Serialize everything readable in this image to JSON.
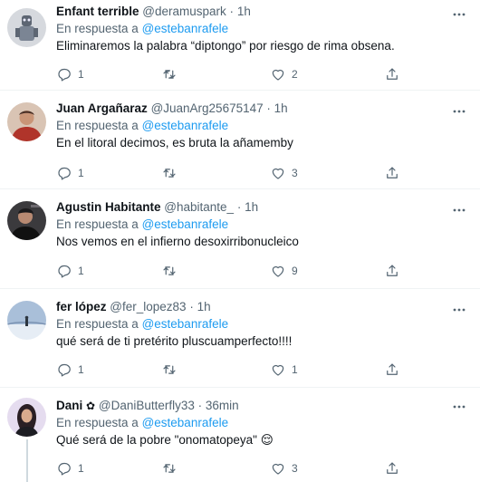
{
  "tweets": [
    {
      "name": "Enfant terrible",
      "handle": "@deramuspark",
      "sep": "·",
      "time": "1h",
      "reply_prefix": "En respuesta a",
      "reply_to": "@estebanrafele",
      "text": "Eliminaremos la palabra “diptongo” por riesgo de rima obsena.",
      "replies": "1",
      "retweets": "",
      "likes": "2",
      "avatar_color": "#c9ccd1"
    },
    {
      "name": "Juan Argañaraz",
      "handle": "@JuanArg25675147",
      "sep": "·",
      "time": "1h",
      "reply_prefix": "En respuesta a",
      "reply_to": "@estebanrafele",
      "text": "En el litoral decimos, es bruta la añamemby",
      "replies": "1",
      "retweets": "",
      "likes": "3",
      "avatar_color": "#b84a3c"
    },
    {
      "name": "Agustin Habitante",
      "handle": "@habitante_",
      "sep": "·",
      "time": "1h",
      "reply_prefix": "En respuesta a",
      "reply_to": "@estebanrafele",
      "text": "Nos vemos en el infierno desoxirribonucleico",
      "replies": "1",
      "retweets": "",
      "likes": "9",
      "avatar_color": "#2c2a2e"
    },
    {
      "name": "fer lópez",
      "handle": "@fer_lopez83",
      "sep": "·",
      "time": "1h",
      "reply_prefix": "En respuesta a",
      "reply_to": "@estebanrafele",
      "text": "qué será de ti pretérito pluscuamperfecto!!!!",
      "replies": "1",
      "retweets": "",
      "likes": "1",
      "avatar_color": "#8fa6c4"
    },
    {
      "name": "Dani",
      "flower": "✿",
      "handle": "@DaniButterfly33",
      "sep": "·",
      "time": "36min",
      "reply_prefix": "En respuesta a",
      "reply_to": "@estebanrafele",
      "text": "Qué será de la pobre \"onomatopeya\" 😌",
      "replies": "1",
      "retweets": "",
      "likes": "3",
      "avatar_color": "#d8c6e8"
    }
  ],
  "icons": {
    "reply": "reply-icon",
    "retweet": "retweet-icon",
    "like": "heart-icon",
    "share": "share-icon",
    "more": "more-icon"
  },
  "colors": {
    "accent": "#1d9bf0",
    "secondary_text": "#536471",
    "divider": "#eff3f4"
  }
}
